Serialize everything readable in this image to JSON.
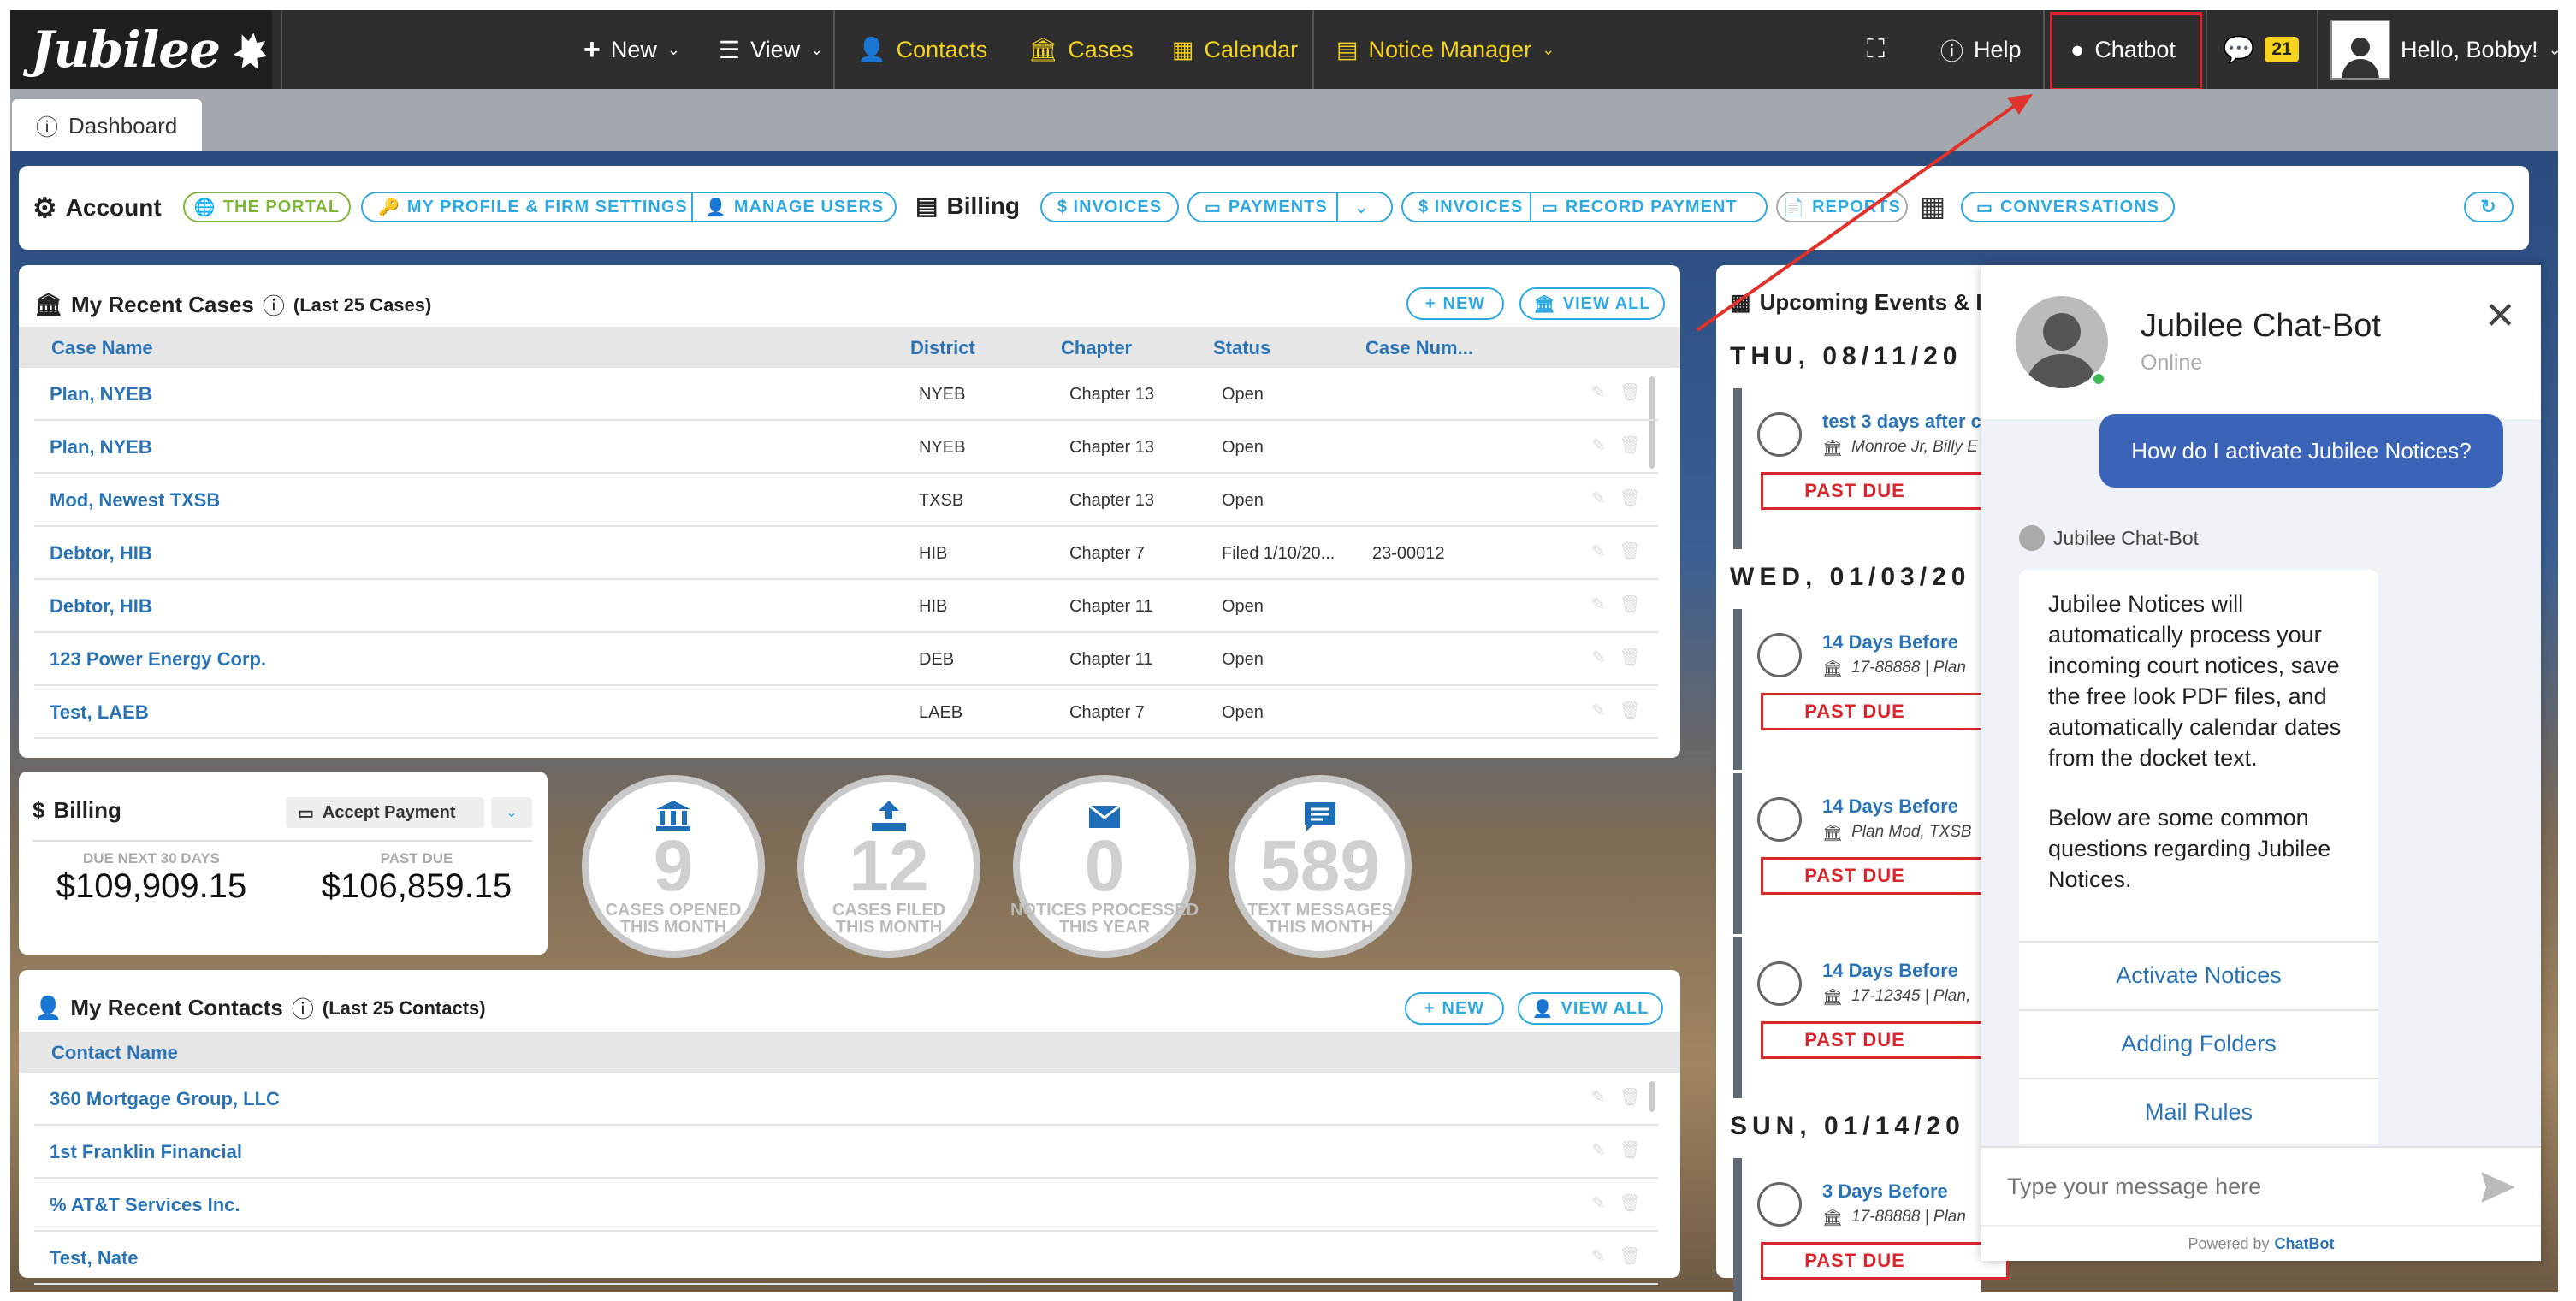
{
  "topnav": {
    "logo": "Jubilee",
    "new": "New",
    "view": "View",
    "contacts": "Contacts",
    "cases": "Cases",
    "calendar": "Calendar",
    "notice_manager": "Notice Manager",
    "help": "Help",
    "chatbot": "Chatbot",
    "messages_count": "21",
    "greeting": "Hello, Bobby!"
  },
  "tabs": {
    "dashboard": "Dashboard"
  },
  "account_bar": {
    "account_title": "Account",
    "the_portal": "THE PORTAL",
    "profile_settings": "MY PROFILE & FIRM SETTINGS",
    "manage_users": "MANAGE USERS",
    "billing_title": "Billing",
    "invoices1": "$ INVOICES",
    "payments": "PAYMENTS",
    "invoices2": "$ INVOICES",
    "record_payment": "RECORD PAYMENT",
    "reports": "REPORTS",
    "conversations": "CONVERSATIONS"
  },
  "recent_cases": {
    "title": "My Recent Cases",
    "subtitle": "(Last 25 Cases)",
    "new_label": "NEW",
    "view_all_label": "VIEW ALL",
    "columns": [
      "Case Name",
      "District",
      "Chapter",
      "Status",
      "Case Num..."
    ],
    "rows": [
      {
        "name": "Plan, NYEB",
        "district": "NYEB",
        "chapter": "Chapter 13",
        "status": "Open",
        "num": ""
      },
      {
        "name": "Plan, NYEB",
        "district": "NYEB",
        "chapter": "Chapter 13",
        "status": "Open",
        "num": ""
      },
      {
        "name": "Mod, Newest TXSB",
        "district": "TXSB",
        "chapter": "Chapter 13",
        "status": "Open",
        "num": ""
      },
      {
        "name": "Debtor, HIB",
        "district": "HIB",
        "chapter": "Chapter 7",
        "status": "Filed 1/10/20...",
        "num": "23-00012"
      },
      {
        "name": "Debtor, HIB",
        "district": "HIB",
        "chapter": "Chapter 11",
        "status": "Open",
        "num": ""
      },
      {
        "name": "123 Power Energy Corp.",
        "district": "DEB",
        "chapter": "Chapter 11",
        "status": "Open",
        "num": ""
      },
      {
        "name": "Test, LAEB",
        "district": "LAEB",
        "chapter": "Chapter 7",
        "status": "Open",
        "num": ""
      }
    ]
  },
  "billing": {
    "title": "Billing",
    "accept_payment": "Accept Payment",
    "due_label": "DUE NEXT 30 DAYS",
    "due_value": "$109,909.15",
    "past_due_label": "PAST DUE",
    "past_due_value": "$106,859.15"
  },
  "stats": [
    {
      "value": "9",
      "line1": "CASES OPENED",
      "line2": "THIS MONTH"
    },
    {
      "value": "12",
      "line1": "CASES FILED",
      "line2": "THIS MONTH"
    },
    {
      "value": "0",
      "line1": "NOTICES PROCESSED",
      "line2": "THIS YEAR"
    },
    {
      "value": "589",
      "line1": "TEXT MESSAGES",
      "line2": "THIS MONTH"
    }
  ],
  "recent_contacts": {
    "title": "My Recent Contacts",
    "subtitle": "(Last 25 Contacts)",
    "new_label": "NEW",
    "view_all_label": "VIEW ALL",
    "column": "Contact Name",
    "rows": [
      "360 Mortgage Group, LLC",
      "1st Franklin Financial",
      "% AT&T Services Inc.",
      "Test, Nate"
    ]
  },
  "events": {
    "title": "Upcoming Events & I",
    "days": [
      "THU, 08/11/20",
      "WED, 01/03/20",
      "SUN, 01/14/20"
    ],
    "items": [
      {
        "title": "test 3 days after c",
        "sub": "Monroe Jr, Billy E",
        "status": "PAST DUE"
      },
      {
        "title": "14 Days Before",
        "sub": "17-88888 | Plan",
        "status": "PAST DUE"
      },
      {
        "title": "14 Days Before",
        "sub": "Plan Mod, TXSB",
        "status": "PAST DUE"
      },
      {
        "title": "14 Days Before",
        "sub": "17-12345 | Plan,",
        "status": "PAST DUE"
      },
      {
        "title": "3 Days Before",
        "sub": "17-88888 | Plan",
        "status": "PAST DUE"
      }
    ]
  },
  "chatbot": {
    "name": "Jubilee Chat-Bot",
    "status": "Online",
    "user_message": "How do I activate Jubilee Notices?",
    "bot_label": "Jubilee Chat-Bot",
    "bot_message_p1": "Jubilee Notices will automatically process your incoming court notices, save the free look PDF files, and automatically calendar dates from the docket text.",
    "bot_message_p2": "Below are some common questions regarding Jubilee Notices.",
    "options": [
      "Activate Notices",
      "Adding Folders",
      "Mail Rules"
    ],
    "input_placeholder": "Type your message here",
    "powered_by": "Powered by",
    "powered_brand": "ChatBot"
  },
  "colors": {
    "accent": "#2fa9e1",
    "link": "#2a73b5",
    "nav_yellow": "#f4d21e",
    "past_due": "#d9262c",
    "chat_bubble": "#3b64b8"
  }
}
